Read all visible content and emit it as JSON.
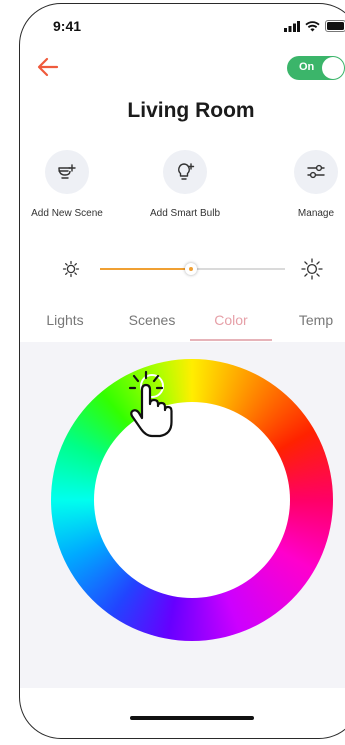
{
  "status_bar": {
    "time": "9:41",
    "icons": [
      "signal-icon",
      "wifi-icon",
      "battery-icon"
    ]
  },
  "header": {
    "back_icon": "arrow-left-icon",
    "power_toggle": {
      "label": "On",
      "state": "on",
      "color": "#3bb56a"
    },
    "title": "Living Room"
  },
  "actions": [
    {
      "label": "Add New Scene",
      "icon": "add-scene-icon"
    },
    {
      "label": "Add Smart Bulb",
      "icon": "add-bulb-icon"
    },
    {
      "label": "Manage",
      "icon": "sliders-icon"
    }
  ],
  "brightness": {
    "min_icon": "sun-dim-icon",
    "max_icon": "sun-bright-icon",
    "level": 0.49,
    "accent_color": "#f0a033"
  },
  "tabs": [
    {
      "label": "Lights",
      "active": false
    },
    {
      "label": "Scenes",
      "active": false
    },
    {
      "label": "Color",
      "active": true
    },
    {
      "label": "Temp",
      "active": false
    }
  ],
  "color_picker": {
    "type": "hue-ring",
    "gesture_icon": "tap-hand-icon",
    "selected_hue": "green"
  }
}
